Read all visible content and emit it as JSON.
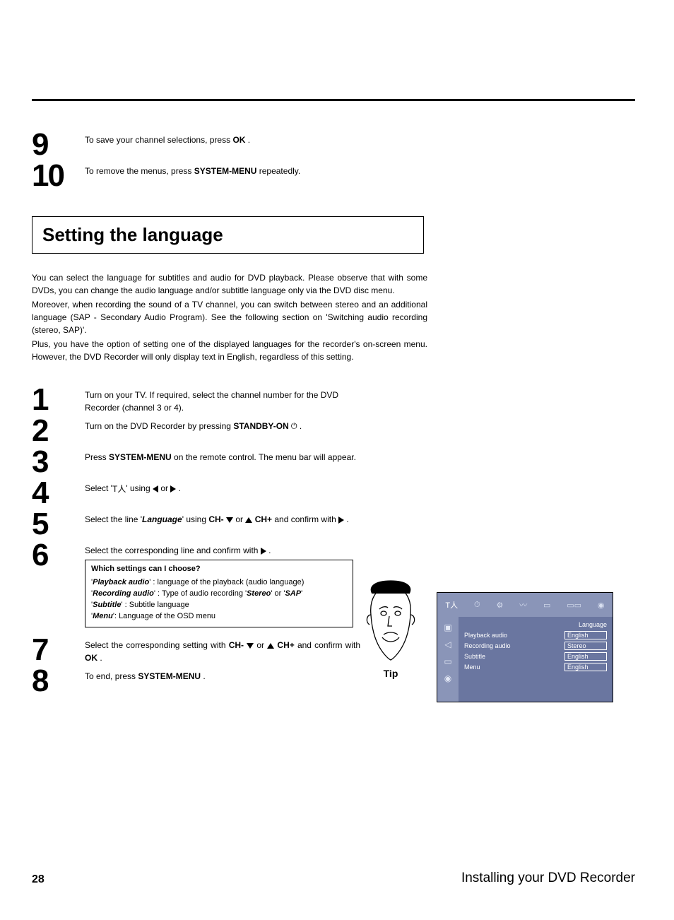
{
  "top_steps": {
    "s9": {
      "num": "9",
      "pre": "To save your channel selections, press ",
      "btn": "OK",
      "post": " ."
    },
    "s10": {
      "num": "10",
      "pre": "To remove the menus, press ",
      "btn": "SYSTEM-MENU",
      "post": " repeatedly."
    }
  },
  "section_title": "Setting the language",
  "intro": {
    "p1": "You can select the language for subtitles and audio for DVD playback. Please observe that with some DVDs, you can change the audio language and/or subtitle language only via the DVD disc menu.",
    "p2": "Moreover, when recording the sound of a TV channel, you can switch between stereo and an additional language (SAP - Secondary Audio Program). See the following section on 'Switching audio recording (stereo, SAP)'.",
    "p3": "Plus, you have the option of setting one of the displayed languages for the recorder's on-screen menu. However, the DVD Recorder will only display text in English, regardless of this setting."
  },
  "steps": {
    "s1": {
      "num": "1",
      "text": "Turn on your TV. If required, select the channel number for the DVD Recorder (channel 3 or 4)."
    },
    "s2": {
      "num": "2",
      "pre": "Turn on the DVD Recorder by pressing ",
      "btn": "STANDBY-ON",
      "post": " ."
    },
    "s3": {
      "num": "3",
      "pre": "Press ",
      "btn": "SYSTEM-MENU",
      "post": " on the remote control. The menu bar will appear."
    },
    "s4": {
      "num": "4",
      "pre": "Select '",
      "mid": "' using ",
      "or": " or ",
      "post": " ."
    },
    "s5": {
      "num": "5",
      "pre": "Select the line '",
      "lang": "Language",
      "mid": "' using ",
      "chm": "CH-",
      "or": " or ",
      "chp": "CH+",
      "post2": " and confirm with ",
      "post3": " ."
    },
    "s6": {
      "num": "6",
      "pre": "Select the corresponding line and confirm with ",
      "post": " ."
    },
    "s7": {
      "num": "7",
      "pre": "Select the corresponding setting with ",
      "chm": "CH-",
      "or": " or ",
      "chp": "CH+",
      "post2": " and confirm with ",
      "ok": "OK",
      "post3": " ."
    },
    "s8": {
      "num": "8",
      "pre": "To end, press ",
      "btn": "SYSTEM-MENU",
      "post": " ."
    }
  },
  "tipbox": {
    "q": "Which settings can I choose?",
    "l1a": "Playback audio",
    "l1b": " : language of the playback (audio language)",
    "l2a": "Recording audio",
    "l2b": " : Type of audio recording '",
    "l2c": "Stereo",
    "l2d": "' or '",
    "l2e": "SAP",
    "l2f": "'",
    "l3a": "Subtitle",
    "l3b": " : Subtitle language",
    "l4a": "Menu",
    "l4b": ": Language of the OSD menu"
  },
  "tip_label": "Tip",
  "osd": {
    "heading": "Language",
    "rows": [
      {
        "label": "Playback audio",
        "value": "English"
      },
      {
        "label": "Recording audio",
        "value": "Stereo"
      },
      {
        "label": "Subtitle",
        "value": "English"
      },
      {
        "label": "Menu",
        "value": "English"
      }
    ]
  },
  "footer": {
    "page": "28",
    "chapter": "Installing your DVD Recorder"
  }
}
